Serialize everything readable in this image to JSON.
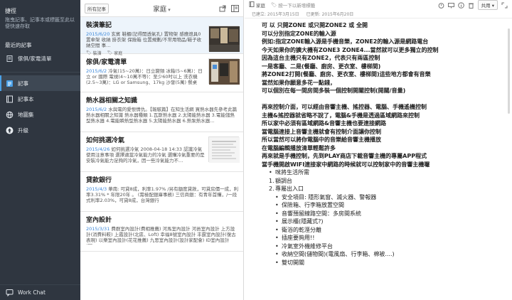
{
  "sidebar": {
    "shortcuts_title": "捷徑",
    "shortcuts_desc": "拖曳記事、記事本或標籤至此以便快速存取",
    "recent_title": "最近的記事",
    "recent_item": "傢俱/家電清單",
    "items": [
      {
        "label": "記事",
        "icon": "note-icon"
      },
      {
        "label": "記事本",
        "icon": "notebook-icon"
      },
      {
        "label": "地圖集",
        "icon": "atlas-icon"
      },
      {
        "label": "升級",
        "icon": "upgrade-icon"
      }
    ],
    "work_chat": "Work Chat"
  },
  "list": {
    "all_notes_button": "所有記事",
    "notebook_title": "家庭",
    "notes": [
      {
        "title": "裝潢筆記",
        "date": "2015/6/20",
        "snippet": "玄賓 鞋櫃(記得開透氣孔) 置物架 感應燈具0 置傘架 收納 掛衣架 保險箱 位置規劃/不常用物品/鞋子收納空間 事…",
        "tags": [
          "裝潢",
          "家庭"
        ]
      },
      {
        "title": "傢俱/家電清單",
        "date": "2015/6/2",
        "snippet": "冷氣(15~20萬)：日立變頻 冰箱(5~6萬)：日立 or 國際 電視(4~10萬不等)：至少60吋以上 洗衣機(2.5~3萬)：LG or Samsung、17kg 沙發(5萬) 餐桌(2…"
      },
      {
        "title": "熱水器相關之知識",
        "date": "2015/6/2",
        "snippet": "水與電的愛恨情仇。【報駭篇】在知生活網 買熱水器先參考此篇 熱水器相關之知識 熱水器種類 1.瓦斯熱水器 2.太陽能熱水器 3.電能儲熱型熱水器 4.電能瞬熱型熱水器 5.太陽能熱水器 6.熱泵熱水器…"
      },
      {
        "title": "如何挑選冷氣",
        "date": "2015/4/26",
        "snippet": "如何挑選冷氣 2008-04-18 14:33 認識冷氣 使用注意事項 選擇適當冷氣能力的冷氣 選購冷氣重要的是安裝冷氣能力足夠的冷氣，因一些冷氣能力不…"
      },
      {
        "title": "貸款銀行",
        "date": "2015/4/3",
        "snippet": "華南: 可貸8成，利率1.97% /另有額度貸款，可貸房價一成，利率3.31% * 年限20年 。 (需檢配銀庫事務) 三信商銀：有青年首購，/一段式利率2.03%，可貸8成，台灣銀行"
      },
      {
        "title": "室內設計",
        "date": "2015/3/31",
        "snippet": "費群室內設計(費相推薦) 河馬室內設計 河邑室內設計 上方設計(消費料較) 上霞設計(北區、Loft) 幸福8號室內設計 丰霆室內設計(復古表現) 以樂室內設計(花花推薦) 九思室內設計(設計家配會) ID室內設計(同…"
      }
    ]
  },
  "editor": {
    "notebook": "家庭",
    "tag_placeholder": "按一下以新增標籤",
    "share_label": "共用",
    "created": "已建立: 2015年3月15日",
    "updated": "已更新: 2015年6月20日",
    "bold_lines_1": [
      "可 以 只開ZONE 或只開ZONE2 或 全開",
      "可以分別指定ZONE的輸入源",
      "例如:指定ZONE輸入源是手機音樂，ZONE2的輸入源是網路電台",
      "今天如果你的擴大機有ZONE3 ZONE4...當然就可以更多獨立的控制",
      "因為這台主機只有ZONE2，代表只有兩區控制",
      "一是客廳、二是(餐廳、廚房、更衣室、樓梯間)",
      "將ZONE2打開(餐廳、廚房、更衣室、樓梯間)這些地方都會有音樂",
      "當然如果你願意多花一點錢，",
      "可以個別在每一間房間多裝一個控制開關控制(開關/音量)"
    ],
    "bold_lines_2": [
      "再來控制介面，可以經由音響主機、搖控器、電腦、手機遙機控制",
      "主機&搖控器就省略不說了，電腦&手機是透過區域網路來控制",
      "所以家中必須有區域網路&音響主機也要連接網路",
      "當電腦連接上音響主機就會有控制介面讓你控制",
      "所以當然可以將你電腦中的音樂給音響主機播放",
      "在電腦編輯播放清單輕鬆許多",
      "再來就是手機控制，先到PLAY商店下載音響主機的專屬APP程式",
      "當手機開啟WIFI連接家中網路的時候就可以控制家中的音響主機囉"
    ],
    "list_items": [
      {
        "type": "bullet",
        "text": "咪將生活所需"
      },
      {
        "type": "num",
        "n": "1.",
        "text": "額調台"
      },
      {
        "type": "num",
        "n": "2.",
        "text": "專屬出入口"
      },
      {
        "type": "sub",
        "text": "安全項目: 隱形氣窗、滅火器、警報器"
      },
      {
        "type": "sub",
        "text": "保險箱、行李箱放置空間"
      },
      {
        "type": "sub",
        "text": "音響預留線路空間：多房間系統"
      },
      {
        "type": "sub",
        "text": "展示櫃(隱藏式?)"
      },
      {
        "type": "sub",
        "text": "衛浴的乾溼分離"
      },
      {
        "type": "sub",
        "text": "插座要夠用!!"
      },
      {
        "type": "sub",
        "text": "冷氣室外機維修平台"
      },
      {
        "type": "sub",
        "text": "收納空間(儲物間)(電風扇、行李箱、棉被....)"
      },
      {
        "type": "sub",
        "text": "雙切開關"
      }
    ]
  }
}
